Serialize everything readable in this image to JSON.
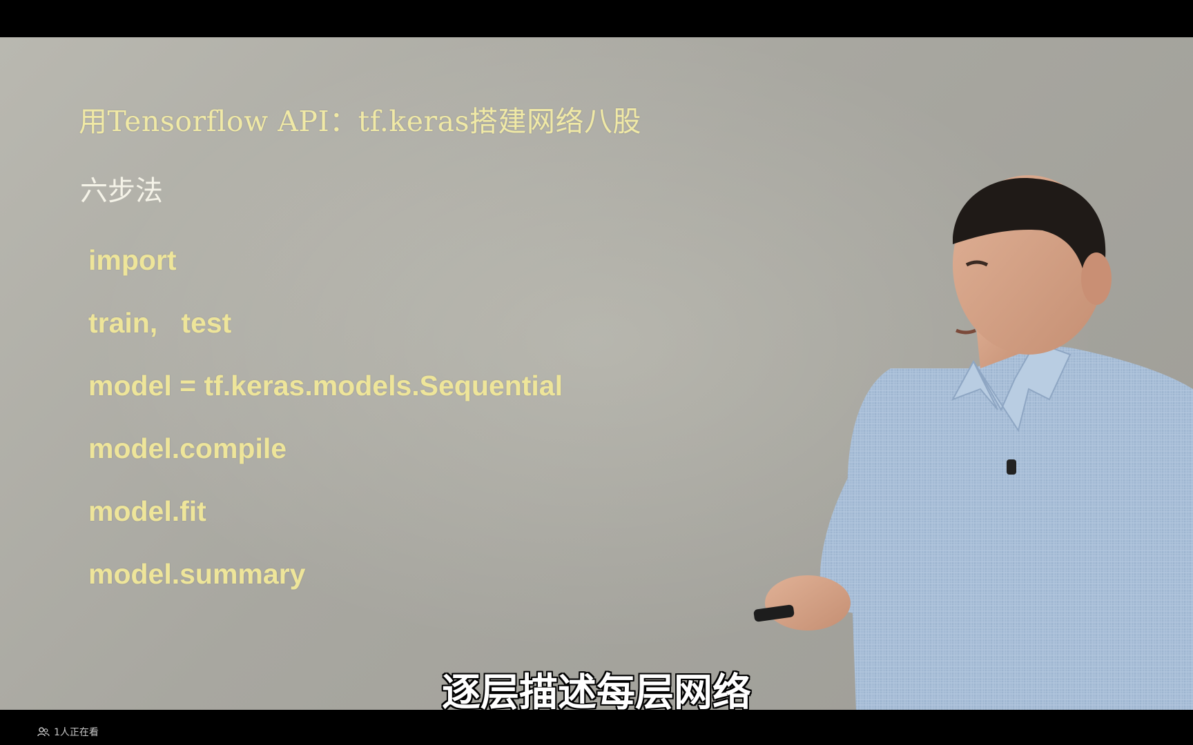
{
  "slide": {
    "title": "用Tensorflow API：tf.keras搭建网络八股",
    "subtitle": "六步法",
    "steps": [
      "import",
      "train,   test",
      "model = tf.keras.models.Sequential",
      "model.compile",
      "model.fit",
      "model.summary"
    ]
  },
  "caption": {
    "text": "逐层描述每层网络"
  },
  "status": {
    "viewer_text": "1人正在看",
    "viewer_icon": "people-icon"
  },
  "colors": {
    "title": "#f0e9a6",
    "code": "#eee59a",
    "background": "#aeada6"
  }
}
